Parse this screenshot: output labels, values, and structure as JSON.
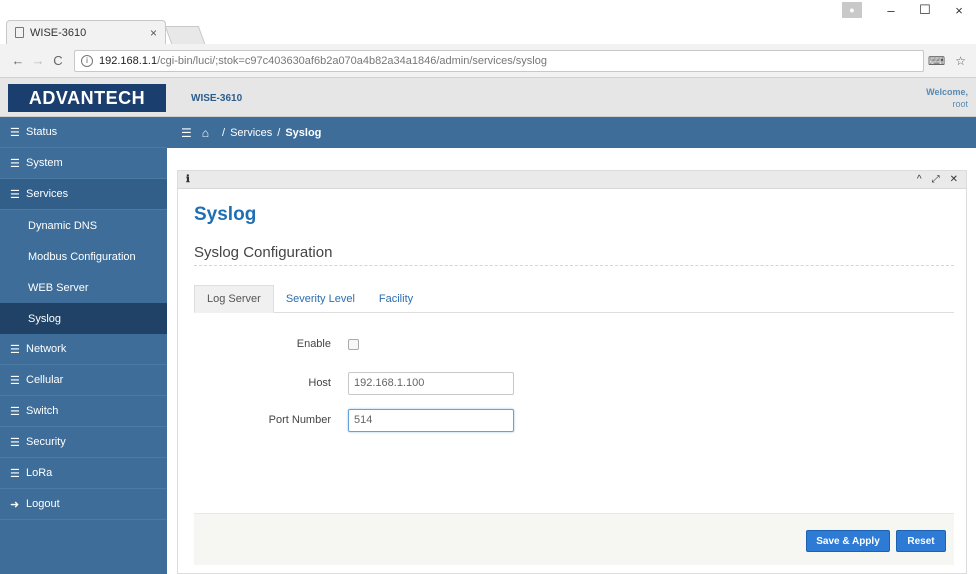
{
  "browser": {
    "tab_title": "WISE-3610",
    "tab_close": "×",
    "url_host": "192.168.1.1",
    "url_path": "/cgi-bin/luci/;stok=c97c403630af6b2a070a4b82a34a1846/admin/services/syslog",
    "win_min": "–",
    "win_max": "☐",
    "win_close": "×"
  },
  "header": {
    "logo": "ADVANTECH",
    "device": "WISE-3610",
    "welcome": "Welcome,",
    "user": "root"
  },
  "sidebar": {
    "items": [
      {
        "label": "Status"
      },
      {
        "label": "System"
      },
      {
        "label": "Services"
      },
      {
        "label": "Network"
      },
      {
        "label": "Cellular"
      },
      {
        "label": "Switch"
      },
      {
        "label": "Security"
      },
      {
        "label": "LoRa"
      },
      {
        "label": "Logout"
      }
    ],
    "services_sub": [
      {
        "label": "Dynamic DNS"
      },
      {
        "label": "Modbus Configuration"
      },
      {
        "label": "WEB Server"
      },
      {
        "label": "Syslog"
      }
    ]
  },
  "breadcrumb": {
    "section": "Services",
    "page": "Syslog"
  },
  "main": {
    "title": "Syslog",
    "section_title": "Syslog Configuration",
    "tabs": [
      {
        "label": "Log Server"
      },
      {
        "label": "Severity Level"
      },
      {
        "label": "Facility"
      }
    ],
    "fields": {
      "enable_label": "Enable",
      "host_label": "Host",
      "host_value": "192.168.1.100",
      "port_label": "Port Number",
      "port_value": "514"
    },
    "buttons": {
      "save_apply": "Save & Apply",
      "reset": "Reset"
    }
  }
}
